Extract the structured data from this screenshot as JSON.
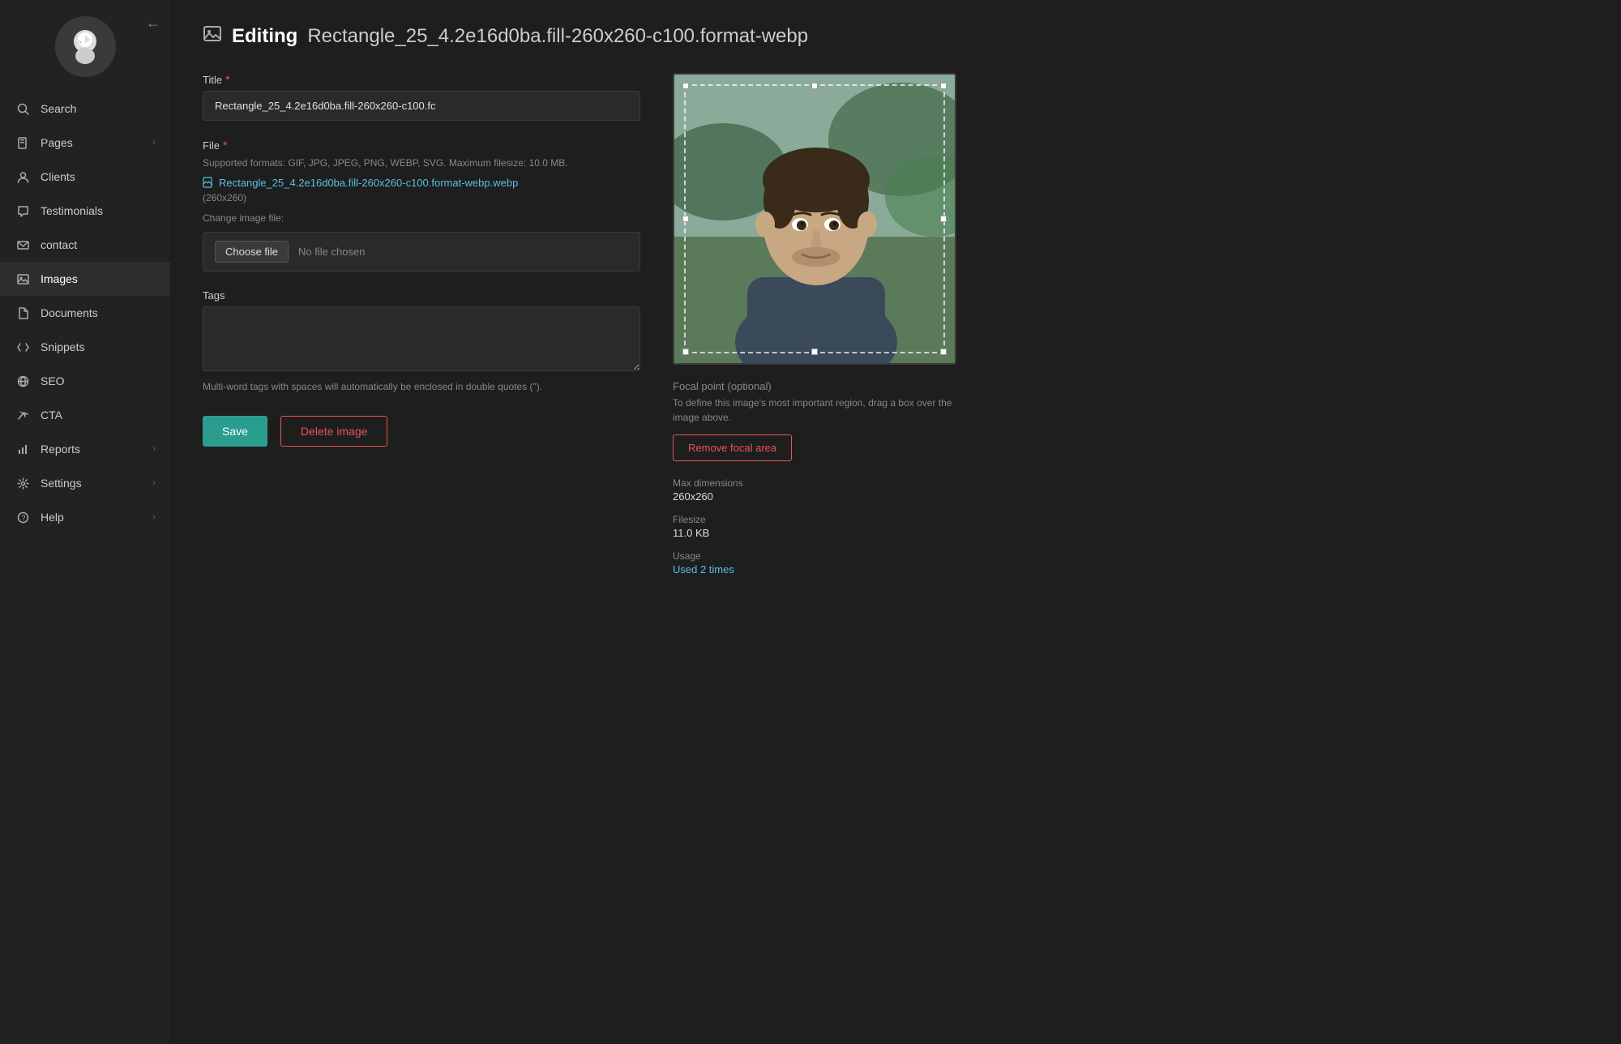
{
  "sidebar": {
    "collapse_label": "←",
    "items": [
      {
        "id": "search",
        "label": "Search",
        "icon": "🔍",
        "has_arrow": false
      },
      {
        "id": "pages",
        "label": "Pages",
        "icon": "📁",
        "has_arrow": true
      },
      {
        "id": "clients",
        "label": "Clients",
        "icon": "👤",
        "has_arrow": false
      },
      {
        "id": "testimonials",
        "label": "Testimonials",
        "icon": "💬",
        "has_arrow": false
      },
      {
        "id": "contact",
        "label": "contact",
        "icon": "✉",
        "has_arrow": false
      },
      {
        "id": "images",
        "label": "Images",
        "icon": "🖼",
        "has_arrow": false,
        "active": true
      },
      {
        "id": "documents",
        "label": "Documents",
        "icon": "📄",
        "has_arrow": false
      },
      {
        "id": "snippets",
        "label": "Snippets",
        "icon": "✏",
        "has_arrow": false
      },
      {
        "id": "seo",
        "label": "SEO",
        "icon": "🌐",
        "has_arrow": false
      },
      {
        "id": "cta",
        "label": "CTA",
        "icon": "🌿",
        "has_arrow": false
      },
      {
        "id": "reports",
        "label": "Reports",
        "icon": "📊",
        "has_arrow": true
      },
      {
        "id": "settings",
        "label": "Settings",
        "icon": "⚙",
        "has_arrow": true
      },
      {
        "id": "help",
        "label": "Help",
        "icon": "❓",
        "has_arrow": true
      }
    ]
  },
  "header": {
    "icon": "🖼",
    "editing_label": "Editing",
    "filename": "Rectangle_25_4.2e16d0ba.fill-260x260-c100.format-webp"
  },
  "form": {
    "title_label": "Title",
    "title_value": "Rectangle_25_4.2e16d0ba.fill-260x260-c100.fc",
    "file_label": "File",
    "file_formats": "Supported formats: GIF, JPG, JPEG, PNG, WEBP, SVG. Maximum filesize: 10.0 MB.",
    "current_file_name": "Rectangle_25_4.2e16d0ba.fill-260x260-c100.format-webp.webp",
    "current_file_dims": "(260x260)",
    "change_image_label": "Change image file:",
    "choose_file_btn": "Choose file",
    "no_file_text": "No file chosen",
    "tags_label": "Tags",
    "tags_hint": "Multi-word tags with spaces will automatically be enclosed in double quotes (\").",
    "save_label": "Save",
    "delete_label": "Delete image"
  },
  "focal": {
    "title": "Focal point",
    "optional_label": "(optional)",
    "description": "To define this image's most important region, drag a box over the image above.",
    "remove_label": "Remove focal area"
  },
  "meta": {
    "max_dim_label": "Max dimensions",
    "max_dim_value": "260x260",
    "filesize_label": "Filesize",
    "filesize_value": "11.0 KB",
    "usage_label": "Usage",
    "usage_value": "Used 2 times"
  }
}
